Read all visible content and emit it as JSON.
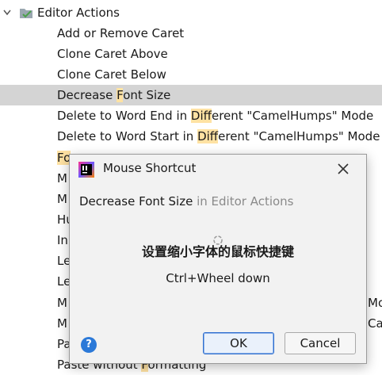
{
  "tree": {
    "group": {
      "label": "Editor Actions"
    },
    "items": [
      {
        "label": "Add or Remove Caret"
      },
      {
        "label": "Clone Caret Above"
      },
      {
        "label": "Clone Caret Below"
      },
      {
        "pre": "Decrease ",
        "hl": "F",
        "post": "ont Size",
        "selected": true
      },
      {
        "pre": "Delete to Word End in ",
        "hl": "Diff",
        "post": "erent \"CamelHumps\" Mode"
      },
      {
        "pre": "Delete to Word Start in ",
        "hl": "Diff",
        "post": "erent \"CamelHumps\" Mode"
      }
    ],
    "obscured_left": [
      "Fo",
      "M",
      "M",
      "Hu",
      "In",
      "Le",
      "Le",
      "M",
      "M",
      "Pa"
    ],
    "obscured_right": [
      "Mo",
      "Ca"
    ],
    "last_item": {
      "pre": "Paste without ",
      "hl": "F",
      "post": "ormatting"
    }
  },
  "dialog": {
    "title": "Mouse Shortcut",
    "action_name": "Decrease Font Size",
    "action_context": " in Editor Actions",
    "hint": "设置缩小字体的鼠标快捷键",
    "shortcut": "Ctrl+Wheel down",
    "help_label": "?",
    "ok_label": "OK",
    "cancel_label": "Cancel"
  },
  "colors": {
    "selection": "#d4d4d4",
    "match_highlight": "#ffe2a3",
    "accent": "#2b79d8"
  }
}
